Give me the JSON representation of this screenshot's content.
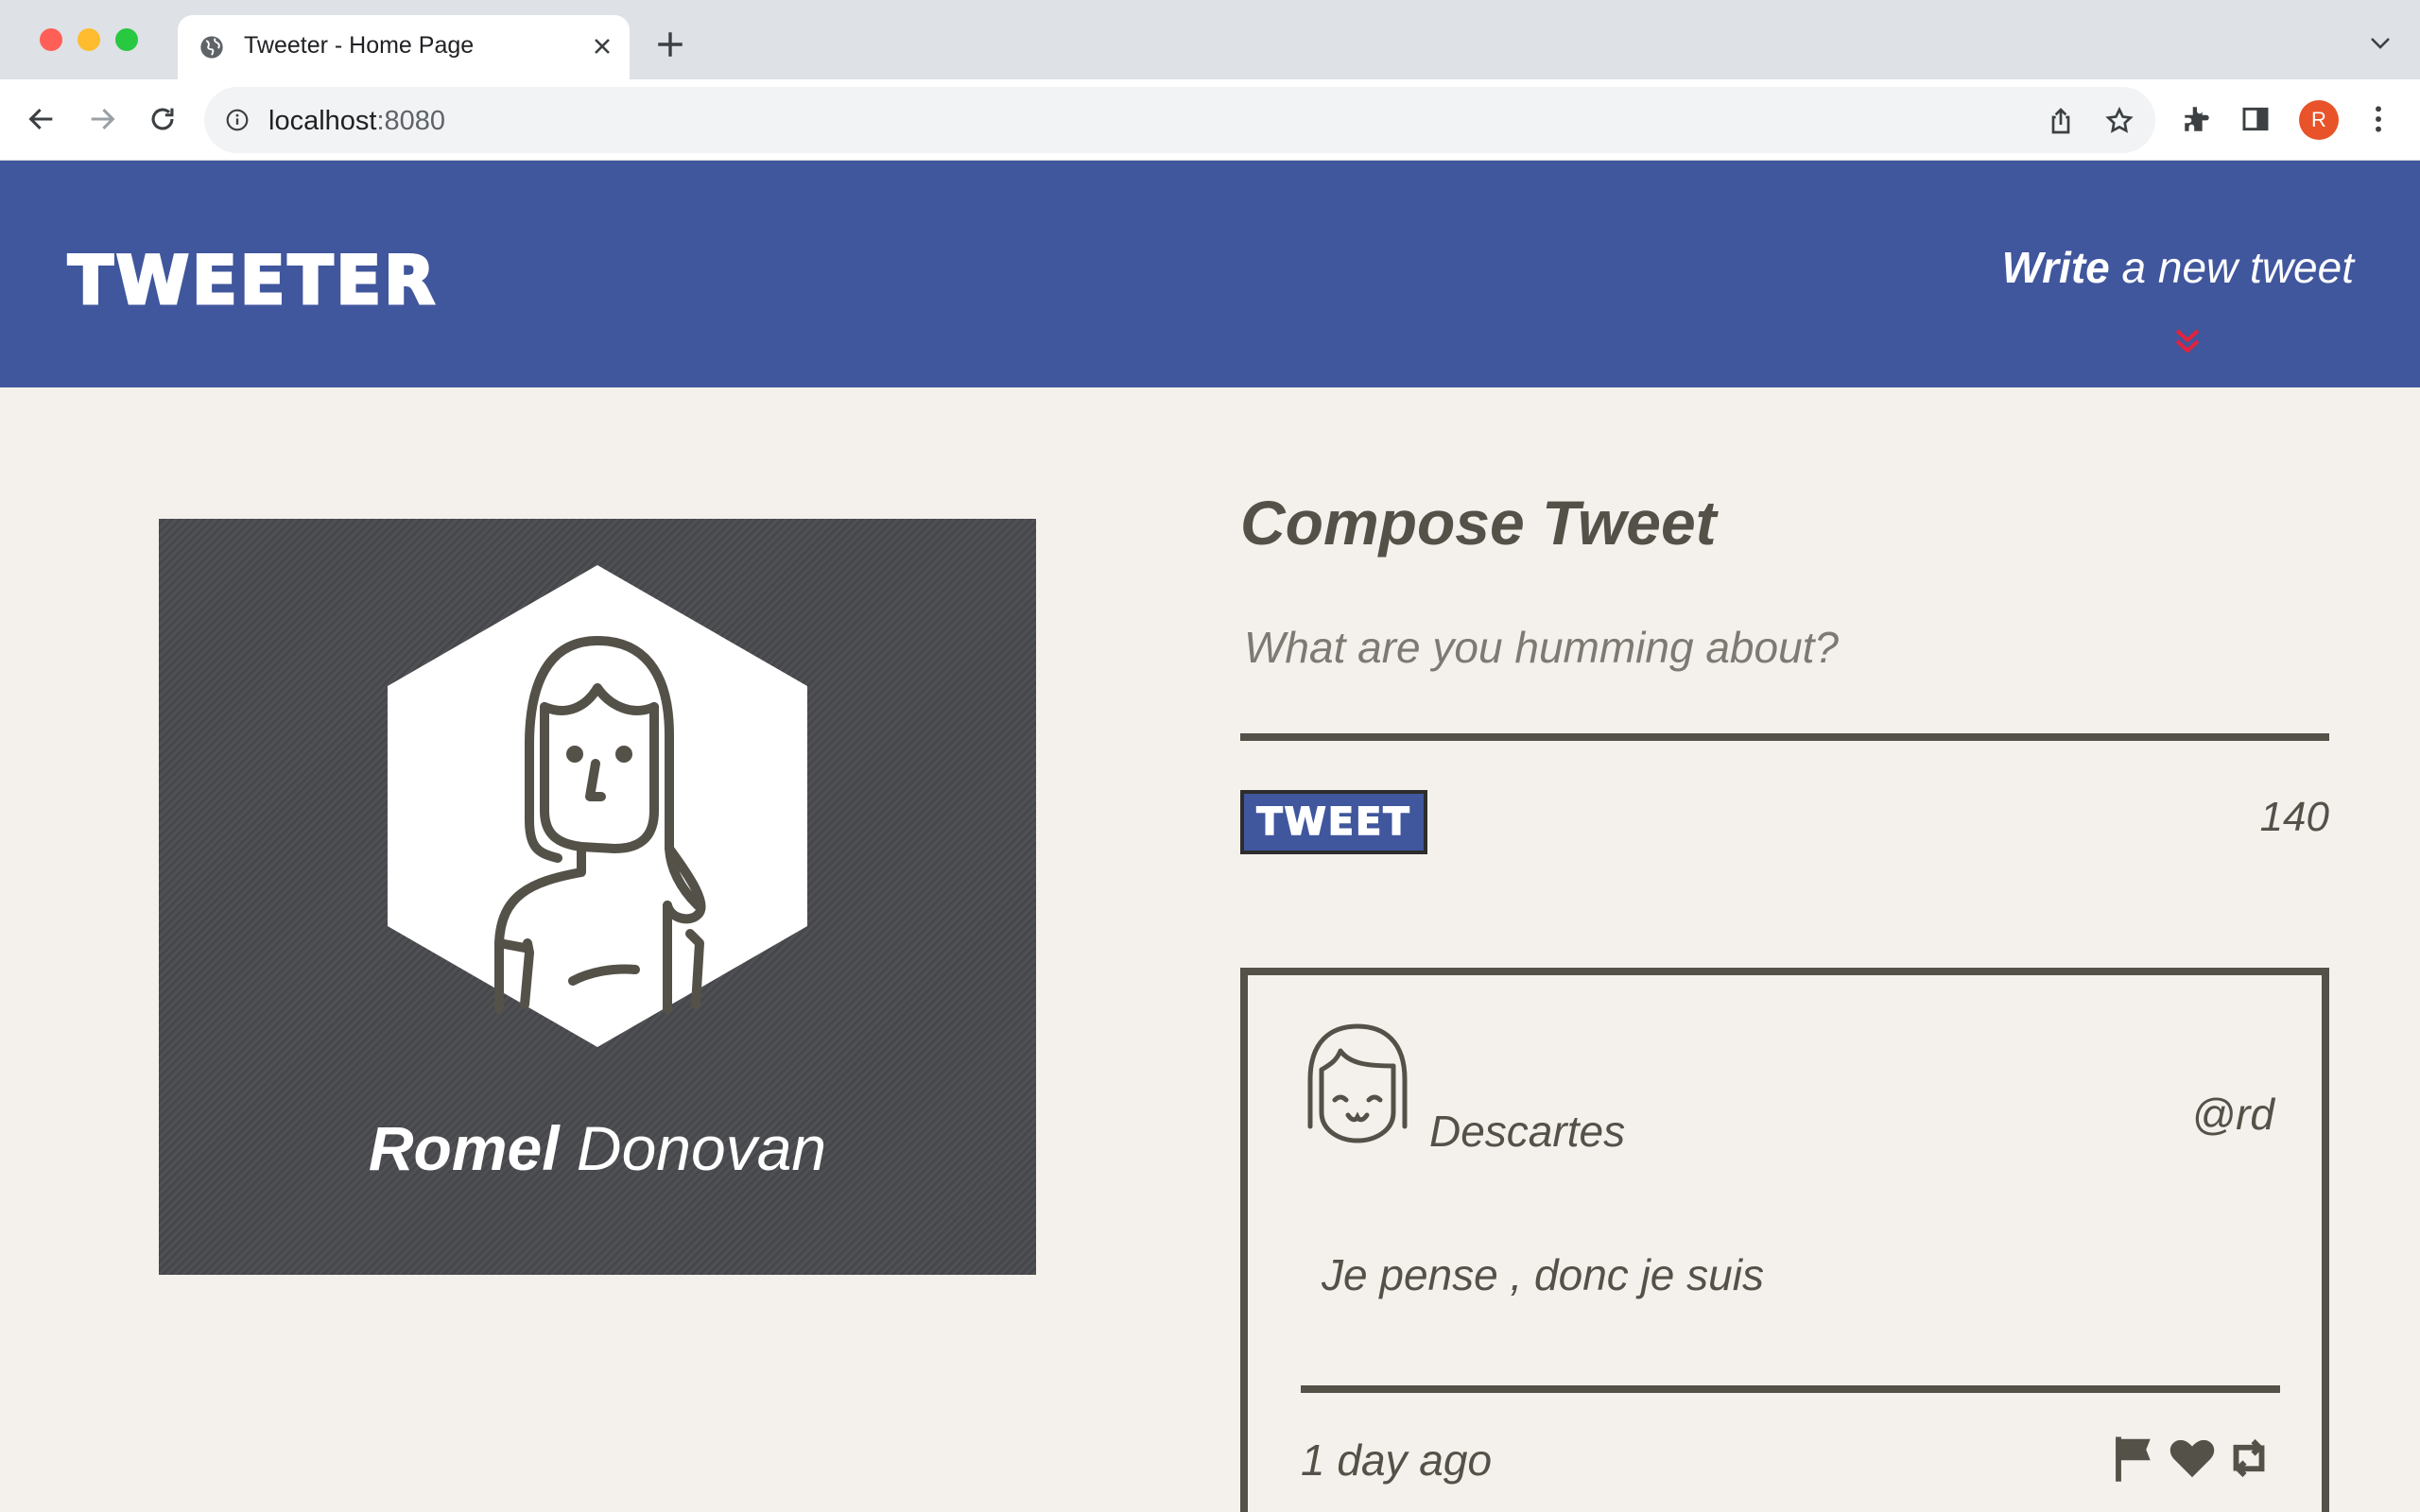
{
  "browser": {
    "tab_title": "Tweeter - Home Page",
    "url_host": "localhost",
    "url_port": ":8080",
    "profile_initial": "R"
  },
  "header": {
    "brand": "TWEETER",
    "write_bold": "Write",
    "write_rest": " a new tweet"
  },
  "profile": {
    "first_name": "Romel",
    "last_name": " Donovan"
  },
  "compose": {
    "title": "Compose Tweet",
    "placeholder": "What are you humming about?",
    "button_label": "TWEET",
    "counter": "140"
  },
  "tweet": {
    "name": "Descartes",
    "handle": "@rd",
    "content": "Je pense , donc je suis",
    "time": "1 day ago",
    "actions": [
      "flag-icon",
      "heart-icon",
      "retweet-icon"
    ]
  },
  "colors": {
    "header_bg": "#40569d",
    "page_bg": "#f4f1ec",
    "text": "#545149",
    "accent_chevron": "#e0243b"
  }
}
